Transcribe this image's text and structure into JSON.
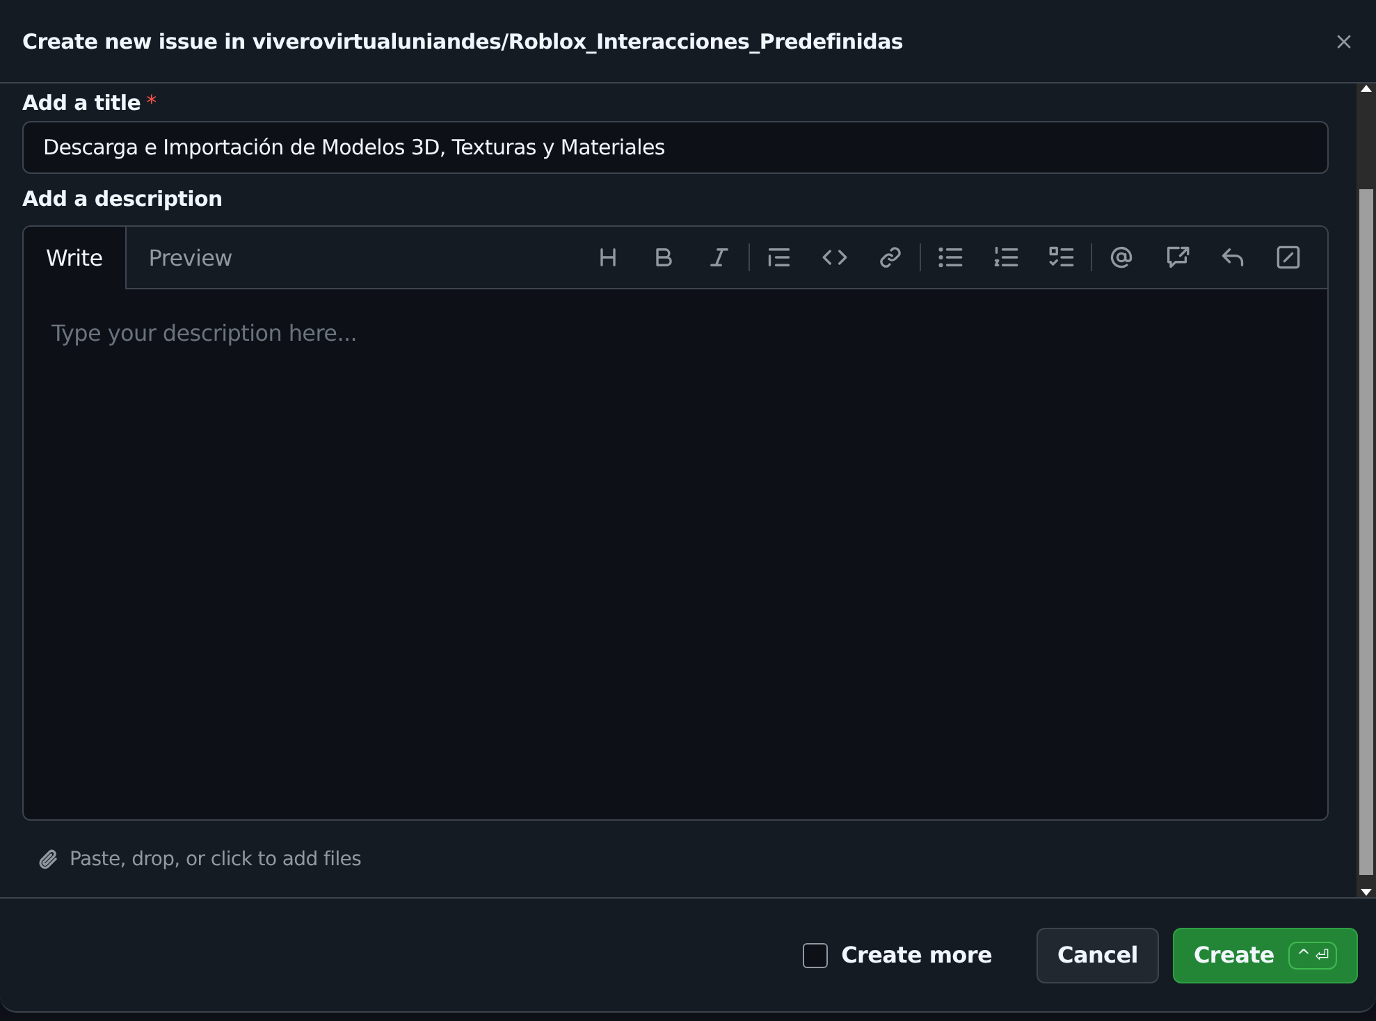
{
  "dialog": {
    "title": "Create new issue in viverovirtualuniandes/Roblox_Interacciones_Predefinidas"
  },
  "title_field": {
    "label": "Add a title",
    "required_mark": "*",
    "value": "Descarga e Importación de Modelos 3D, Texturas y Materiales"
  },
  "description": {
    "label": "Add a description",
    "tabs": [
      {
        "label": "Write",
        "selected": true
      },
      {
        "label": "Preview",
        "selected": false
      }
    ],
    "placeholder": "Type your description here...",
    "attach_hint": "Paste, drop, or click to add files"
  },
  "footer": {
    "create_more": {
      "label": "Create more",
      "checked": false
    },
    "buttons": [
      {
        "kind": "secondary",
        "label": "Cancel"
      },
      {
        "kind": "primary",
        "label": "Create",
        "shortcut": "^ ⏎"
      }
    ]
  }
}
